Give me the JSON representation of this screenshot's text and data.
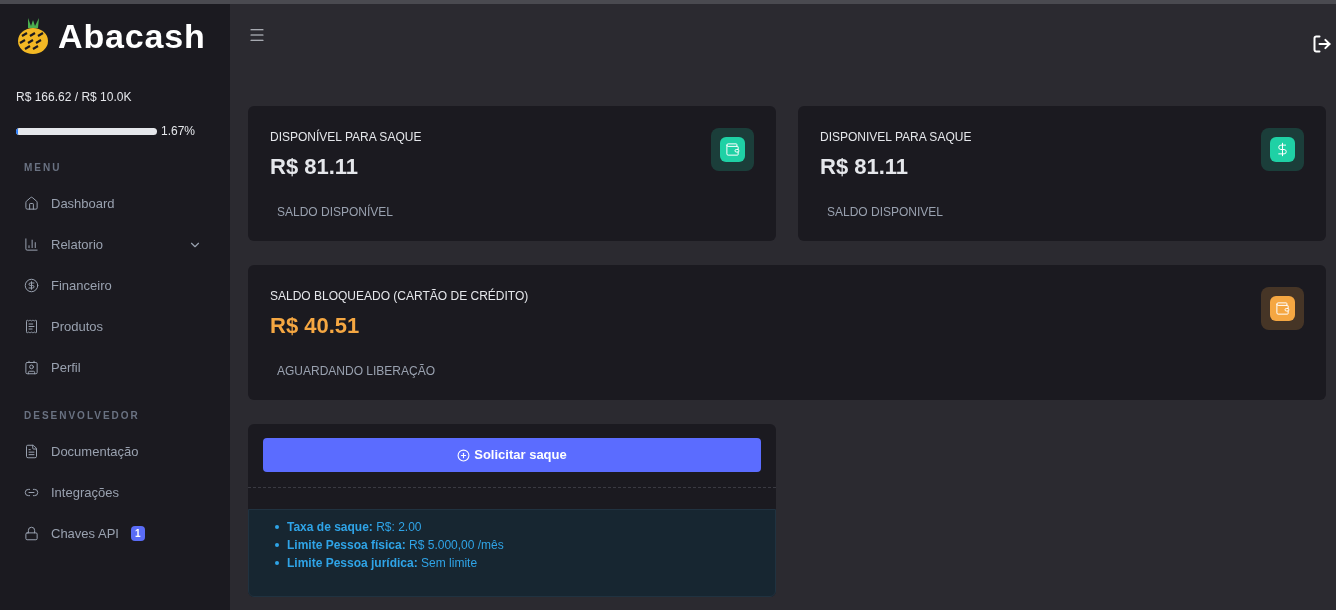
{
  "brand": {
    "name": "Abacash"
  },
  "usage": {
    "text": "R$ 166.62 / R$ 10.0K",
    "level": 0.0167,
    "percent": "1.67%"
  },
  "sidebar": {
    "sections": [
      {
        "title": "MENU",
        "items": [
          {
            "label": "Dashboard",
            "kind": "home",
            "expandable": false
          },
          {
            "label": "Relatorio",
            "kind": "chart",
            "expandable": true
          },
          {
            "label": "Financeiro",
            "kind": "dollar",
            "expandable": false
          },
          {
            "label": "Produtos",
            "kind": "product",
            "expandable": false
          },
          {
            "label": "Perfil",
            "kind": "profile",
            "expandable": false
          }
        ]
      },
      {
        "title": "DESENVOLVEDOR",
        "items": [
          {
            "label": "Documentação",
            "kind": "doc",
            "expandable": false
          },
          {
            "label": "Integrações",
            "kind": "link",
            "expandable": false
          },
          {
            "label": "Chaves API",
            "kind": "lock",
            "expandable": false,
            "badge": "1"
          }
        ]
      }
    ]
  },
  "cards": [
    {
      "title": "DISPONÍVEL PARA SAQUE",
      "value": "R$ 81.11",
      "caption": "SALDO DISPONÍVEL",
      "kind": "wallet",
      "color": "#1fd1a5"
    },
    {
      "title": "DISPONIVEL PARA SAQUE",
      "value": "R$ 81.11",
      "caption": "SALDO DISPONIVEL",
      "kind": "dollar",
      "color": "#1fd1a5"
    },
    {
      "title": "SALDO BLOQUEADO (CARTÃO DE CRÉDITO)",
      "value": "R$ 40.51",
      "caption": "AGUARDANDO LIBERAÇÃO",
      "kind": "wallet",
      "color": "#f5a742"
    }
  ],
  "withdraw": {
    "button": "Solicitar saque",
    "info": [
      "**Taxa de saque:** R$: 2.00",
      "**Limite Pessoa física:** R$ 5.000,00 /mês",
      "**Limite Pessoa jurídica:** Sem limite"
    ]
  }
}
